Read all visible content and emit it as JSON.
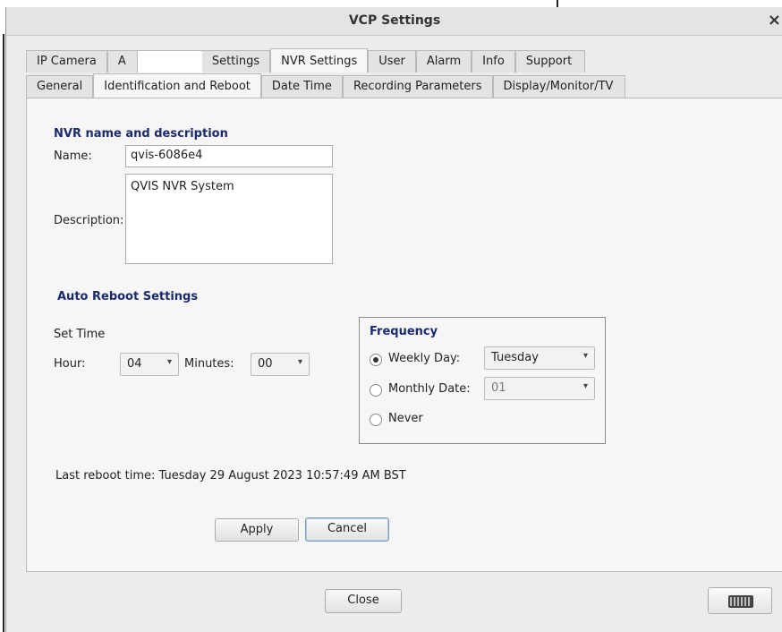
{
  "window": {
    "title": "VCP Settings",
    "close_glyph": "×"
  },
  "main_tabs": [
    {
      "label": "IP Camera"
    },
    {
      "label": "A"
    },
    {
      "label": "Settings"
    },
    {
      "label": "NVR Settings",
      "active": true
    },
    {
      "label": "User"
    },
    {
      "label": "Alarm"
    },
    {
      "label": "Info"
    },
    {
      "label": "Support"
    }
  ],
  "sub_tabs": [
    {
      "label": "General"
    },
    {
      "label": "Identification and Reboot",
      "active": true
    },
    {
      "label": "Date Time"
    },
    {
      "label": "Recording Parameters"
    },
    {
      "label": "Display/Monitor/TV"
    }
  ],
  "nvr": {
    "section_title": "NVR name and description",
    "name_label": "Name:",
    "name_value": "qvis-6086e4",
    "description_label": "Description:",
    "description_value": "QVIS NVR System"
  },
  "reboot": {
    "section_title": "Auto Reboot Settings",
    "set_time_label": "Set Time",
    "hour_label": "Hour:",
    "hour_value": "04",
    "minutes_label": "Minutes:",
    "minutes_value": "00",
    "frequency_title": "Frequency",
    "weekly_label": "Weekly Day:",
    "weekly_value": "Tuesday",
    "monthly_label": "Monthly Date:",
    "monthly_value": "01",
    "never_label": "Never",
    "selected": "weekly",
    "last_reboot": "Last reboot time: Tuesday 29 August 2023 10:57:49 AM BST"
  },
  "buttons": {
    "apply": "Apply",
    "cancel": "Cancel",
    "close": "Close"
  },
  "icons": {
    "dropdown_arrow": "▾",
    "keyboard": "keyboard-icon"
  }
}
